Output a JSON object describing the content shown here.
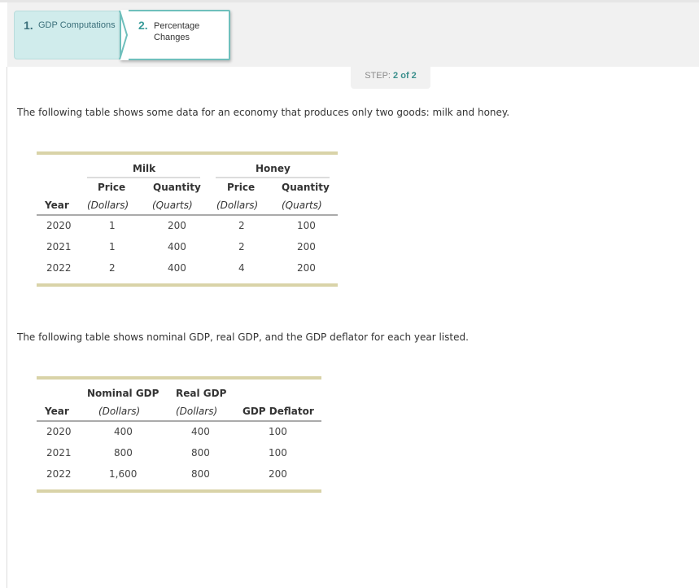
{
  "tabs": [
    {
      "number": "1.",
      "label": "GDP Computations"
    },
    {
      "number": "2.",
      "label_line1": "Percentage",
      "label_line2": "Changes"
    }
  ],
  "step": {
    "prefix": "STEP: ",
    "current": "2 of 2"
  },
  "intro1": "The following table shows some data for an economy that produces only two goods: milk and honey.",
  "table1": {
    "group_milk": "Milk",
    "group_honey": "Honey",
    "col_year": "Year",
    "col_price": "Price",
    "col_quantity": "Quantity",
    "unit_dollars": "(Dollars)",
    "unit_quarts": "(Quarts)",
    "rows": [
      {
        "year": "2020",
        "milk_price": "1",
        "milk_qty": "200",
        "honey_price": "2",
        "honey_qty": "100"
      },
      {
        "year": "2021",
        "milk_price": "1",
        "milk_qty": "400",
        "honey_price": "2",
        "honey_qty": "200"
      },
      {
        "year": "2022",
        "milk_price": "2",
        "milk_qty": "400",
        "honey_price": "4",
        "honey_qty": "200"
      }
    ]
  },
  "intro2": "The following table shows nominal GDP, real GDP, and the GDP deflator for each year listed.",
  "table2": {
    "col_year": "Year",
    "col_nominal": "Nominal GDP",
    "col_real": "Real GDP",
    "unit_dollars": "(Dollars)",
    "col_deflator": "GDP Deflator",
    "rows": [
      {
        "year": "2020",
        "nominal": "400",
        "real": "400",
        "deflator": "100"
      },
      {
        "year": "2021",
        "nominal": "800",
        "real": "800",
        "deflator": "100"
      },
      {
        "year": "2022",
        "nominal": "1,600",
        "real": "800",
        "deflator": "200"
      }
    ]
  },
  "colors": {
    "accent": "#3a9c9a",
    "tab_active_border": "#6fbfbc",
    "tab_inactive_bg": "#d0ecec",
    "rule": "#d9d3a8"
  }
}
